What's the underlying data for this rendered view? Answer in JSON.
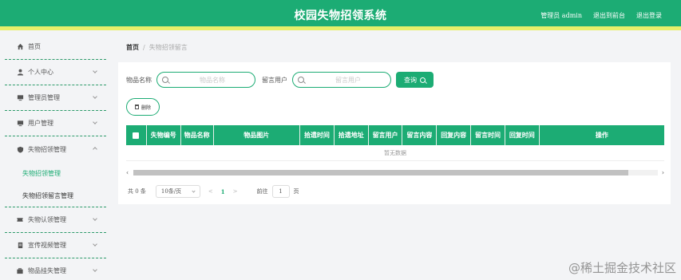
{
  "header": {
    "title": "校园失物招领系统",
    "admin_label": "管理员 admin",
    "exit_front_label": "退出到前台",
    "logout_label": "退出登录"
  },
  "colors": {
    "primary": "#1cac74",
    "accent_bar": "#e6ef6a"
  },
  "sidebar": {
    "items": [
      {
        "label": "首页",
        "icon": "home-icon",
        "has_chevron": false
      },
      {
        "label": "个人中心",
        "icon": "user-icon",
        "has_chevron": true
      },
      {
        "label": "管理员管理",
        "icon": "monitor-icon",
        "has_chevron": true
      },
      {
        "label": "用户管理",
        "icon": "monitor-icon",
        "has_chevron": true
      },
      {
        "label": "失物招领管理",
        "icon": "shield-icon",
        "has_chevron": true,
        "expanded": true,
        "children": [
          {
            "label": "失物招领管理"
          },
          {
            "label": "失物招领留言管理"
          }
        ]
      },
      {
        "label": "失物认领管理",
        "icon": "ticket-icon",
        "has_chevron": true
      },
      {
        "label": "宣传视频管理",
        "icon": "document-icon",
        "has_chevron": true
      },
      {
        "label": "物品挂失管理",
        "icon": "briefcase-icon",
        "has_chevron": true
      }
    ]
  },
  "breadcrumb": {
    "home": "首页",
    "separator": "/",
    "current": "失物招领留言"
  },
  "search": {
    "fields": [
      {
        "label": "物品名称",
        "placeholder": "物品名称"
      },
      {
        "label": "留言用户",
        "placeholder": "留言用户"
      }
    ],
    "query_label": "查询"
  },
  "delete_label": "删除",
  "table": {
    "columns": [
      "",
      "失物编号",
      "物品名称",
      "物品图片",
      "拾遗时间",
      "拾遗地址",
      "留言用户",
      "留言内容",
      "回复内容",
      "留言时间",
      "回复时间",
      "操作"
    ],
    "empty_text": "暂无数据"
  },
  "pagination": {
    "total": "共 0 条",
    "page_size": "10条/页",
    "prev": "<",
    "current_page": "1",
    "next": ">",
    "goto_label": "前往",
    "goto_value": "1",
    "page_suffix": "页"
  },
  "watermark": "@稀土掘金技术社区"
}
